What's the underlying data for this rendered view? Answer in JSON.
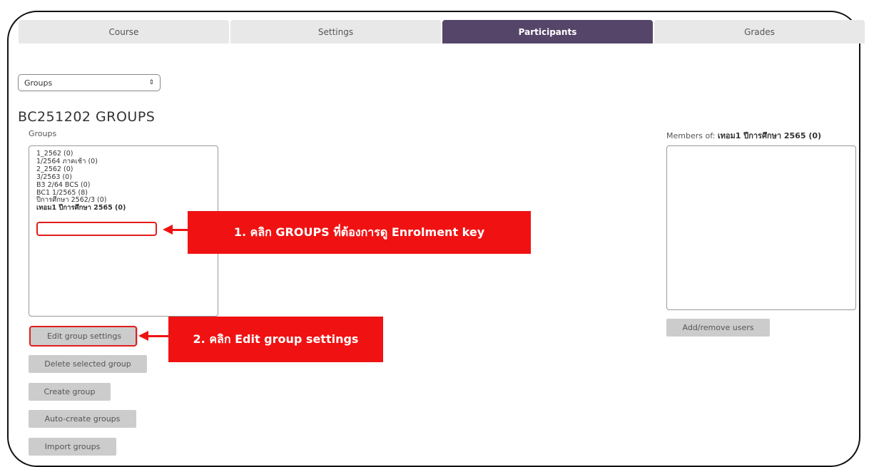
{
  "tabs": [
    "Course",
    "Settings",
    "Participants",
    "Grades"
  ],
  "active_tab": "Participants",
  "view_select": {
    "value": "Groups"
  },
  "page_title": "BC251202 GROUPS",
  "groups_label": "Groups",
  "groups": [
    "1_2562 (0)",
    "1/2564 ภาคเช้า (0)",
    "2_2562 (0)",
    "3/2563 (0)",
    "B3 2/64 BCS (0)",
    "BC1 1/2565 (8)",
    "ปีการศึกษา 2562/3 (0)",
    "เทอม1 ปีการศึกษา 2565 (0)"
  ],
  "selected_group_index": 7,
  "members": {
    "label_prefix": "Members of:",
    "label_group": "เทอม1 ปีการศึกษา 2565 (0)"
  },
  "buttons": {
    "edit_group_settings": "Edit group settings",
    "delete_selected_group": "Delete selected group",
    "create_group": "Create group",
    "auto_create_groups": "Auto-create groups",
    "import_groups": "Import groups",
    "add_remove_users": "Add/remove users"
  },
  "annotations": {
    "step1": "1. คลิก GROUPS ที่ต้องการดู Enrolment key",
    "step2": "2. คลิก Edit group settings"
  },
  "colors": {
    "active_tab": "#554568",
    "highlight": "#e31c1c",
    "callout": "#f01212"
  }
}
